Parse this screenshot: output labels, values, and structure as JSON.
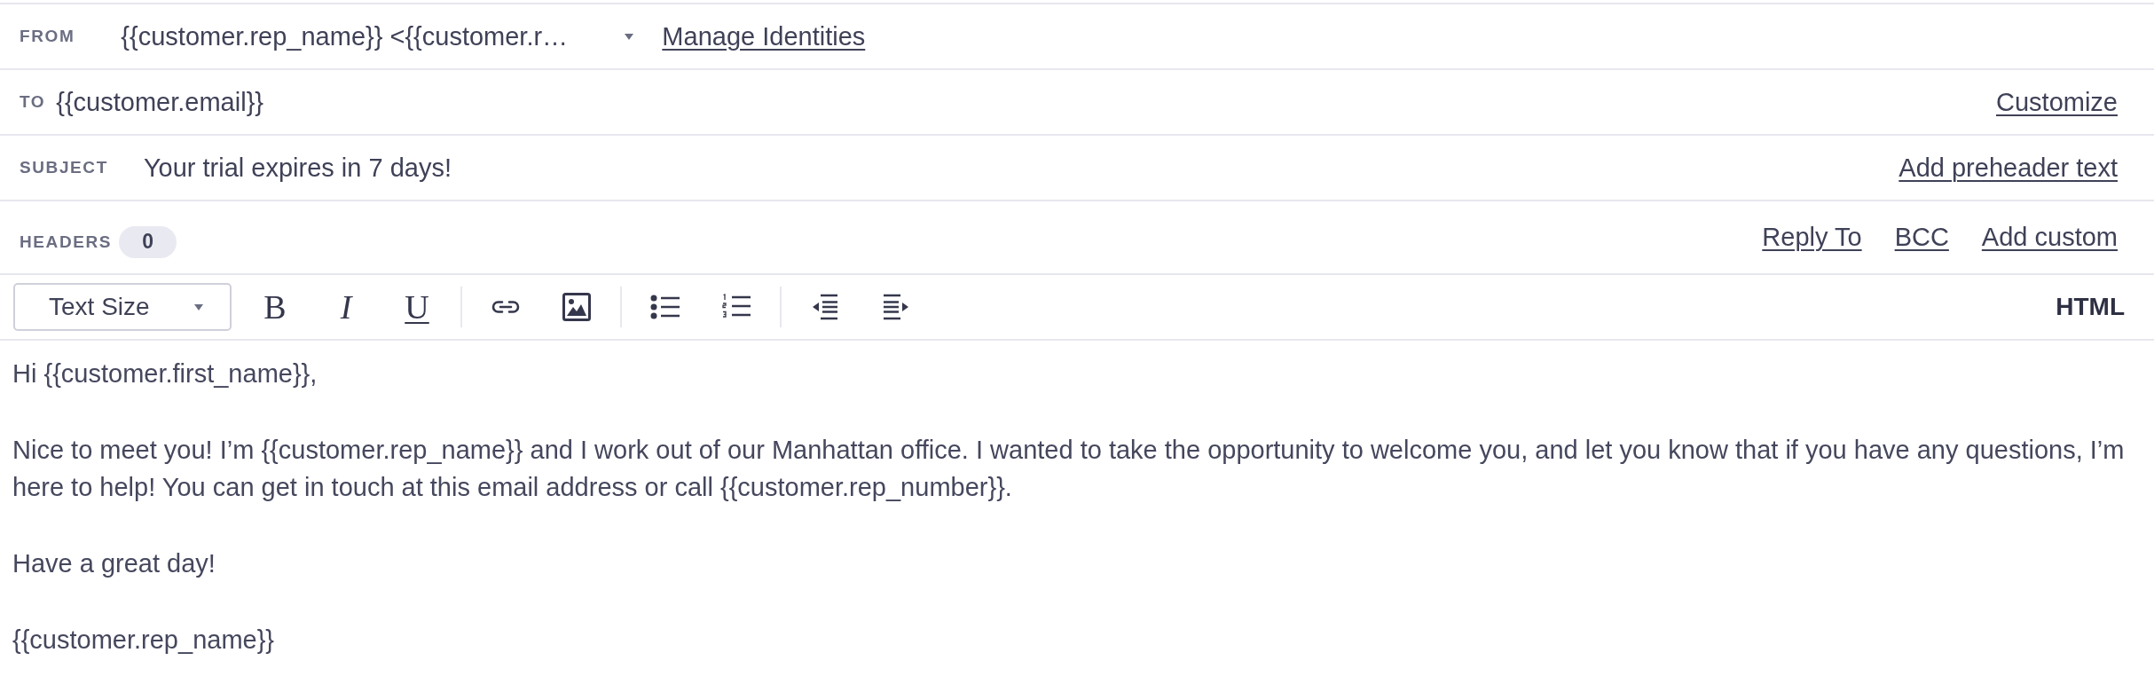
{
  "compose": {
    "from": {
      "label": "FROM",
      "value": "{{customer.rep_name}} <{{customer.r…",
      "link": "Manage Identities"
    },
    "to": {
      "label": "TO",
      "value": "{{customer.email}}",
      "link": "Customize"
    },
    "subject": {
      "label": "SUBJECT",
      "value": "Your trial expires in 7 days!",
      "link": "Add preheader text"
    },
    "headers": {
      "label": "HEADERS",
      "count": "0",
      "links": [
        "Reply To",
        "BCC",
        "Add custom"
      ]
    }
  },
  "toolbar": {
    "text_size": "Text Size",
    "groups": [
      [
        {
          "kind": "bold",
          "label": "B"
        },
        {
          "kind": "italic",
          "label": "I"
        },
        {
          "kind": "underline",
          "label": "U"
        }
      ],
      [
        {
          "kind": "link"
        },
        {
          "kind": "image"
        }
      ],
      [
        {
          "kind": "bulleted_list"
        },
        {
          "kind": "numbered_list"
        }
      ],
      [
        {
          "kind": "outdent"
        },
        {
          "kind": "indent"
        }
      ]
    ],
    "mode": "HTML"
  },
  "body": {
    "paragraphs": [
      "Hi {{customer.first_name}},",
      "Nice to meet you! I’m {{customer.rep_name}} and I work out of our Manhattan office. I wanted to take the opportunity to welcome you, and let you know that if you have any questions, I’m here to help! You can get in touch at this email address or call {{customer.rep_number}}.",
      "Have a great day!",
      "{{customer.rep_name}}"
    ]
  }
}
